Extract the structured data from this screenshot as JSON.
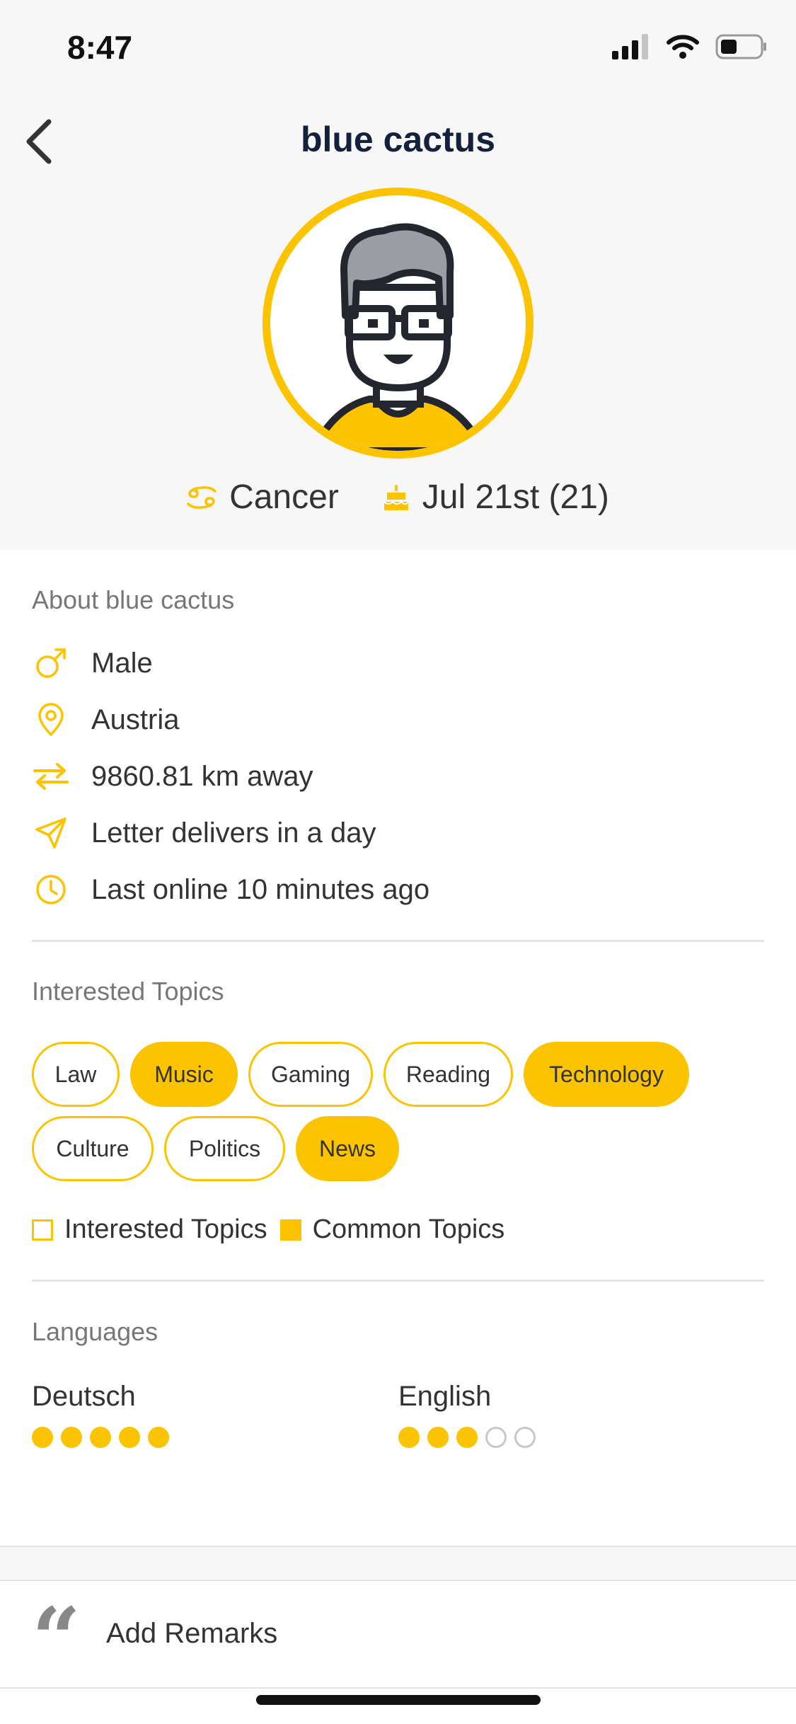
{
  "status_bar": {
    "time": "8:47"
  },
  "header": {
    "title": "blue cactus"
  },
  "profile": {
    "zodiac": "Cancer",
    "birthday": "Jul 21st (21)"
  },
  "about": {
    "title": "About blue cactus",
    "gender": "Male",
    "country": "Austria",
    "distance": "9860.81 km away",
    "delivery": "Letter delivers in a day",
    "last_online": "Last online 10 minutes ago"
  },
  "topics": {
    "title": "Interested Topics",
    "items": [
      {
        "label": "Law",
        "common": false
      },
      {
        "label": "Music",
        "common": true
      },
      {
        "label": "Gaming",
        "common": false
      },
      {
        "label": "Reading",
        "common": false
      },
      {
        "label": "Technology",
        "common": true
      },
      {
        "label": "Culture",
        "common": false
      },
      {
        "label": "Politics",
        "common": false
      },
      {
        "label": "News",
        "common": true
      }
    ],
    "legend_interested": "Interested Topics",
    "legend_common": "Common Topics"
  },
  "languages": {
    "title": "Languages",
    "items": [
      {
        "name": "Deutsch",
        "level": 5,
        "max": 5
      },
      {
        "name": "English",
        "level": 3,
        "max": 5
      }
    ]
  },
  "remarks": {
    "label": "Add Remarks"
  },
  "colors": {
    "accent": "#fbc300",
    "title": "#14213d"
  },
  "icons": [
    "chevron-left-icon",
    "cellular-signal-icon",
    "wifi-icon",
    "battery-icon",
    "cancer-zodiac-icon",
    "cake-icon",
    "male-icon",
    "location-pin-icon",
    "swap-arrows-icon",
    "paper-plane-icon",
    "clock-icon",
    "quote-icon"
  ]
}
